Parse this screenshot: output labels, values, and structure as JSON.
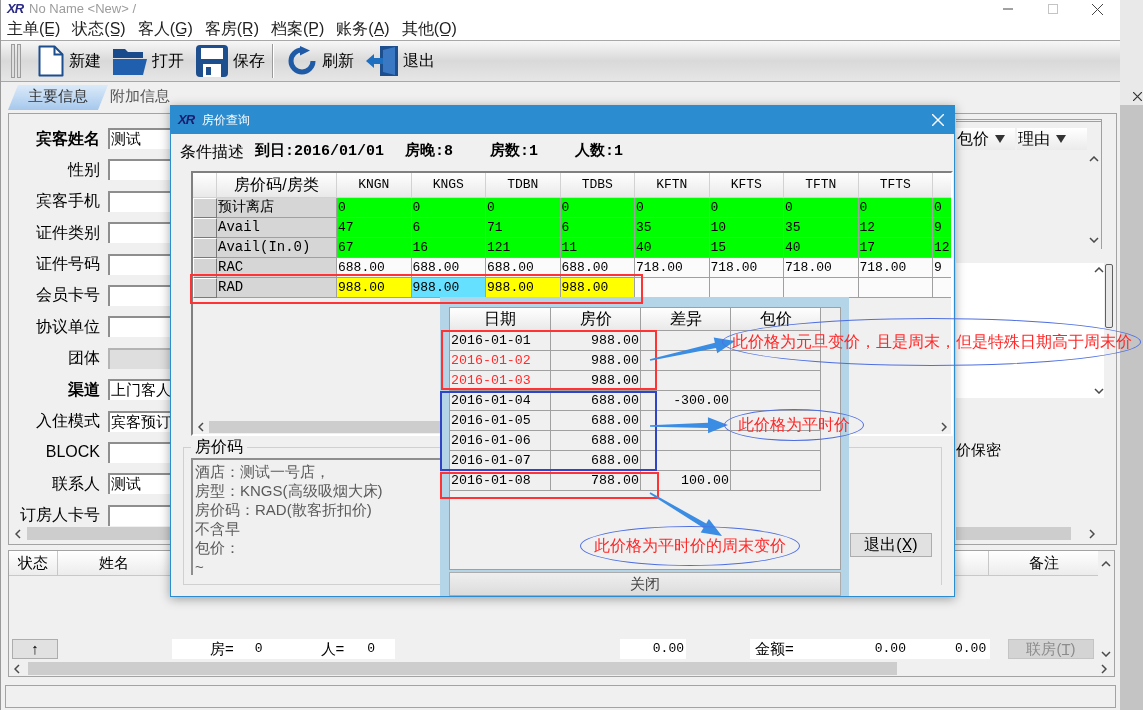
{
  "window": {
    "logo": "XR",
    "title": "No Name <New> /"
  },
  "menu": [
    {
      "label": "主单",
      "mnemonic": "(E)"
    },
    {
      "label": "状态",
      "mnemonic": "(S)"
    },
    {
      "label": "客人",
      "mnemonic": "(G)"
    },
    {
      "label": "客房",
      "mnemonic": "(R)"
    },
    {
      "label": "档案",
      "mnemonic": "(P)"
    },
    {
      "label": "账务",
      "mnemonic": "(A)"
    },
    {
      "label": "其他",
      "mnemonic": "(O)"
    }
  ],
  "toolbar": [
    {
      "items": [
        {
          "label": "新建"
        },
        {
          "label": "打开"
        },
        {
          "label": "保存"
        }
      ]
    },
    {
      "items": [
        {
          "label": "刷新"
        },
        {
          "label": "退出"
        }
      ]
    }
  ],
  "tabs": [
    {
      "label": "主要信息",
      "selected": true
    },
    {
      "label": "附加信息",
      "selected": false
    }
  ],
  "guest_form": {
    "fields": [
      {
        "label": "宾客姓名",
        "value": "测试",
        "bold": true,
        "disabled": false
      },
      {
        "label": "性别",
        "bold": false,
        "disabled": false
      },
      {
        "label": "宾客手机",
        "bold": false,
        "disabled": false
      },
      {
        "label": "证件类别",
        "bold": false,
        "disabled": false
      },
      {
        "label": "证件号码",
        "bold": false,
        "disabled": false
      },
      {
        "label": "会员卡号",
        "bold": false,
        "disabled": false
      },
      {
        "label": "协议单位",
        "bold": false,
        "disabled": false
      },
      {
        "label": "团体",
        "bold": false,
        "disabled": true
      },
      {
        "label": "渠道",
        "value": "上门客人",
        "bold": true,
        "disabled": false
      },
      {
        "label": "入住模式",
        "value": "宾客预订",
        "bold": false,
        "disabled": false
      },
      {
        "label": "BLOCK",
        "bold": false,
        "disabled": false
      },
      {
        "label": "联系人",
        "value": "测试",
        "bold": false,
        "disabled": false
      },
      {
        "label": "订房人卡号",
        "bold": false,
        "disabled": false
      }
    ]
  },
  "package_table": {
    "columns": [
      {
        "label": "包价"
      },
      {
        "label": "理由"
      }
    ]
  },
  "option_label": "价保密",
  "guest_list": {
    "columns": [
      {
        "label": "状态"
      },
      {
        "label": "姓名"
      },
      {
        "label": "备注"
      }
    ],
    "up_button": "↑",
    "summary": {
      "rooms_label": "房=",
      "rooms": "0",
      "guests_label": "人=",
      "guests": "0",
      "total": "0.00",
      "amount_label": "金额=",
      "amount": "0.00",
      "balance": "0.00"
    },
    "link_button": {
      "label": "联房",
      "mnemonic": "(T)",
      "disabled": true
    }
  },
  "dialog": {
    "logo": "XR",
    "title": "房价查询",
    "criteria_label": "条件描述",
    "criteria": [
      "到日:2016/01/01",
      "房晚:8",
      "房数:1",
      "人数:1"
    ],
    "rate_grid": {
      "corner": "房价码/房类",
      "columns": [
        "KNGN",
        "KNGS",
        "TDBN",
        "TDBS",
        "KFTN",
        "KFTS",
        "TFTN",
        "TFTS"
      ],
      "rows": [
        {
          "label": "预计离店",
          "kind": "count",
          "cells": [
            "0",
            "0",
            "0",
            "0",
            "0",
            "0",
            "0",
            "0",
            "0"
          ]
        },
        {
          "label": "Avail",
          "kind": "count",
          "cells": [
            "47",
            "6",
            "71",
            "6",
            "35",
            "10",
            "35",
            "12",
            "9"
          ]
        },
        {
          "label": "Avail(In.0)",
          "kind": "count",
          "cells": [
            "67",
            "16",
            "121",
            "11",
            "40",
            "15",
            "40",
            "17",
            "12"
          ]
        },
        {
          "label": "RAC",
          "kind": "rate",
          "cells": [
            "688.00",
            "688.00",
            "688.00",
            "688.00",
            "718.00",
            "718.00",
            "718.00",
            "718.00",
            "9"
          ]
        },
        {
          "label": "RAD",
          "kind": "rate",
          "cells": [
            {
              "value": "988.00",
              "highlighted": true,
              "selected": false
            },
            {
              "value": "988.00",
              "highlighted": true,
              "selected": true
            },
            {
              "value": "988.00",
              "highlighted": true,
              "selected": false
            },
            {
              "value": "988.00",
              "highlighted": true,
              "selected": false
            }
          ]
        }
      ]
    },
    "rate_code": {
      "label": "房价码",
      "lines": [
        "酒店：测试一号店，",
        "房型：KNGS(高级吸烟大床)",
        "房价码：RAD(散客折扣价)",
        "不含早",
        "包价：",
        "~"
      ]
    },
    "exit_button": {
      "label": "退出",
      "mnemonic": "(X)"
    },
    "price_popup": {
      "columns": [
        "日期",
        "房价",
        "差异",
        "包价"
      ],
      "rows": [
        {
          "date": "2016-01-01",
          "price": "988.00",
          "weekend": false
        },
        {
          "date": "2016-01-02",
          "price": "988.00",
          "weekend": true
        },
        {
          "date": "2016-01-03",
          "price": "988.00",
          "weekend": true
        },
        {
          "date": "2016-01-04",
          "price": "688.00",
          "difference": "-300.00",
          "weekend": false
        },
        {
          "date": "2016-01-05",
          "price": "688.00",
          "weekend": false
        },
        {
          "date": "2016-01-06",
          "price": "688.00",
          "weekend": false
        },
        {
          "date": "2016-01-07",
          "price": "688.00",
          "weekend": false
        },
        {
          "date": "2016-01-08",
          "price": "788.00",
          "difference": "100.00",
          "weekend": false
        }
      ],
      "close_button": "关闭"
    }
  },
  "annotations": {
    "frames": [
      {
        "color": "#ff3333"
      },
      {
        "color": "#ff3333"
      },
      {
        "color": "#2f44c6"
      },
      {
        "color": "#ff3333"
      }
    ],
    "callouts": [
      "此价格为元旦变价，且是周末，但是特殊日期高于周末价",
      "此价格为平时价",
      "此价格为平时价的周末变价"
    ]
  }
}
